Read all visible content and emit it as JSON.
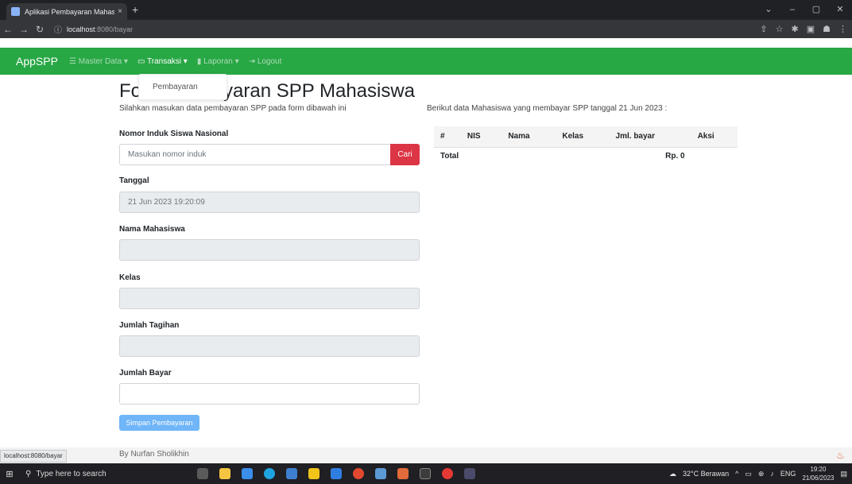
{
  "browser": {
    "tab_title": "Aplikasi Pembayaran Mahasiswa",
    "tab_close": "×",
    "new_tab": "+",
    "url_host": "localhost",
    "url_path": ":8080/bayar",
    "window_controls": [
      "⌄",
      "–",
      "▢",
      "✕"
    ]
  },
  "navbar": {
    "brand": "AppSPP",
    "items": [
      {
        "label": "Master Data",
        "icon": "table-icon"
      },
      {
        "label": "Transaksi",
        "icon": "money-icon"
      },
      {
        "label": "Laporan",
        "icon": "book-icon"
      },
      {
        "label": "Logout",
        "icon": "logout-icon"
      }
    ]
  },
  "dropdown": {
    "item": "Pembayaran"
  },
  "form": {
    "title_prefix": "Fo",
    "title_suffix": "yaran SPP Mahasiswa",
    "subtitle": "Silahkan masukan data pembayaran SPP pada form dibawah ini",
    "nis_label": "Nomor Induk Siswa Nasional",
    "nis_placeholder": "Masukan nomor induk",
    "cari_label": "Cari",
    "tanggal_label": "Tanggal",
    "tanggal_value": "21 Jun 2023 19:20:09",
    "nama_label": "Nama Mahasiswa",
    "kelas_label": "Kelas",
    "tagihan_label": "Jumlah Tagihan",
    "bayar_label": "Jumlah Bayar",
    "submit_label": "Simpan Pembayaran"
  },
  "table": {
    "info": "Berikut data Mahasiswa yang membayar SPP tanggal 21 Jun 2023 :",
    "headers": [
      "#",
      "NIS",
      "Nama",
      "Kelas",
      "Jml. bayar",
      "Aksi"
    ],
    "total_label": "Total",
    "total_value": "Rp. 0"
  },
  "footer": {
    "text": "By Nurfan Sholikhin",
    "status_url": "localhost:8080/bayar"
  },
  "taskbar": {
    "search_placeholder": "Type here to search",
    "weather": "32°C Berawan",
    "lang": "ENG",
    "time": "19:20",
    "date": "21/06/2023"
  },
  "colors": {
    "navbar": "#28a745",
    "danger": "#dc3545",
    "primary_light": "#6fb5f7"
  }
}
